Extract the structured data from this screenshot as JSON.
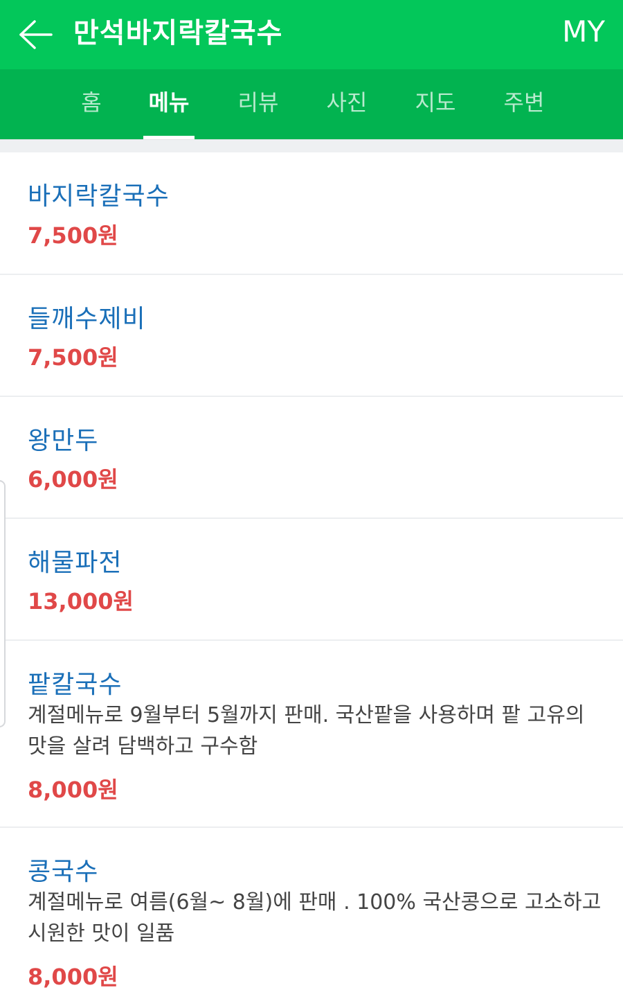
{
  "header": {
    "title": "만석바지락칼국수",
    "my_label": "MY",
    "back_icon": "arrow-left-icon",
    "bg_color": "#03c75a"
  },
  "tabs": [
    {
      "label": "홈",
      "active": false
    },
    {
      "label": "메뉴",
      "active": true
    },
    {
      "label": "리뷰",
      "active": false
    },
    {
      "label": "사진",
      "active": false
    },
    {
      "label": "지도",
      "active": false
    },
    {
      "label": "주변",
      "active": false
    }
  ],
  "menu": [
    {
      "name": "바지락칼국수",
      "price": "7,500원"
    },
    {
      "name": "들깨수제비",
      "price": "7,500원"
    },
    {
      "name": "왕만두",
      "price": "6,000원"
    },
    {
      "name": "해물파전",
      "price": "13,000원"
    },
    {
      "name": "팥칼국수",
      "description": "계절메뉴로 9월부터 5월까지 판매. 국산팥을 사용하며 팥 고유의 맛을 살려 담백하고 구수함",
      "price": "8,000원"
    },
    {
      "name": "콩국수",
      "description": "계절메뉴로 여름(6월~ 8월)에 판매 . 100% 국산콩으로 고소하고 시원한 맛이 일품",
      "price": "8,000원"
    }
  ],
  "colors": {
    "name": "#1a6fb8",
    "price": "#e04848",
    "tab_bg": "#02b350"
  }
}
